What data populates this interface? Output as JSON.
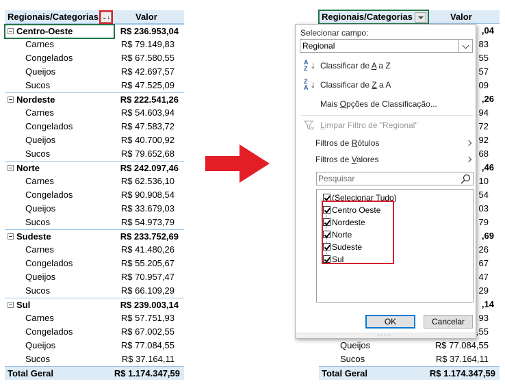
{
  "left_table": {
    "header": {
      "name": "Regionais/Categorias",
      "value": "Valor"
    },
    "groups": [
      {
        "region": "Centro-Oeste",
        "total": "R$ 236.953,04",
        "items": [
          {
            "name": "Carnes",
            "value": "R$ 79.149,83"
          },
          {
            "name": "Congelados",
            "value": "R$ 67.580,55"
          },
          {
            "name": "Queijos",
            "value": "R$ 42.697,57"
          },
          {
            "name": "Sucos",
            "value": "R$ 47.525,09"
          }
        ]
      },
      {
        "region": "Nordeste",
        "total": "R$ 222.541,26",
        "items": [
          {
            "name": "Carnes",
            "value": "R$ 54.603,94"
          },
          {
            "name": "Congelados",
            "value": "R$ 47.583,72"
          },
          {
            "name": "Queijos",
            "value": "R$ 40.700,92"
          },
          {
            "name": "Sucos",
            "value": "R$ 79.652,68"
          }
        ]
      },
      {
        "region": "Norte",
        "total": "R$ 242.097,46",
        "items": [
          {
            "name": "Carnes",
            "value": "R$ 62.536,10"
          },
          {
            "name": "Congelados",
            "value": "R$ 90.908,54"
          },
          {
            "name": "Queijos",
            "value": "R$ 33.679,03"
          },
          {
            "name": "Sucos",
            "value": "R$ 54.973,79"
          }
        ]
      },
      {
        "region": "Sudeste",
        "total": "R$ 233.752,69",
        "items": [
          {
            "name": "Carnes",
            "value": "R$ 41.480,26"
          },
          {
            "name": "Congelados",
            "value": "R$ 55.205,67"
          },
          {
            "name": "Queijos",
            "value": "R$ 70.957,47"
          },
          {
            "name": "Sucos",
            "value": "R$ 66.109,29"
          }
        ]
      },
      {
        "region": "Sul",
        "total": "R$ 239.003,14",
        "items": [
          {
            "name": "Carnes",
            "value": "R$ 57.751,93"
          },
          {
            "name": "Congelados",
            "value": "R$ 67.002,55"
          },
          {
            "name": "Queijos",
            "value": "R$ 77.084,55"
          },
          {
            "name": "Sucos",
            "value": "R$ 37.164,11"
          }
        ]
      }
    ],
    "grand_total": {
      "label": "Total Geral",
      "value": "R$ 1.174.347,59"
    }
  },
  "right_table": {
    "header": {
      "name": "Regionais/Categorias",
      "value": "Valor"
    },
    "visible_values": [
      {
        "text": ",04",
        "bold": true
      },
      {
        "text": "83",
        "bold": false
      },
      {
        "text": "55",
        "bold": false
      },
      {
        "text": "57",
        "bold": false
      },
      {
        "text": "09",
        "bold": false
      },
      {
        "text": ",26",
        "bold": true
      },
      {
        "text": "94",
        "bold": false
      },
      {
        "text": "72",
        "bold": false
      },
      {
        "text": "92",
        "bold": false
      },
      {
        "text": "68",
        "bold": false
      },
      {
        "text": ",46",
        "bold": true
      },
      {
        "text": "10",
        "bold": false
      },
      {
        "text": "54",
        "bold": false
      },
      {
        "text": "03",
        "bold": false
      },
      {
        "text": "79",
        "bold": false
      },
      {
        "text": ",69",
        "bold": true
      },
      {
        "text": "26",
        "bold": false
      },
      {
        "text": "67",
        "bold": false
      },
      {
        "text": "47",
        "bold": false
      },
      {
        "text": "29",
        "bold": false
      },
      {
        "text": ",14",
        "bold": true
      },
      {
        "text": "93",
        "bold": false
      },
      {
        "text": ",55",
        "bold": false
      }
    ],
    "bottom_rows": [
      {
        "name": "Queijos",
        "value": "R$ 77.084,55"
      },
      {
        "name": "Sucos",
        "value": "R$ 37.164,11"
      }
    ],
    "grand_total": {
      "label": "Total Geral",
      "value": "R$ 1.174.347,59"
    }
  },
  "menu": {
    "field_label": "Selecionar campo:",
    "field_value": "Regional",
    "sort_asc": {
      "pre": "Classificar de ",
      "key": "A",
      "post": " a Z",
      "icon_top": "A",
      "icon_bottom": "Z"
    },
    "sort_desc": {
      "pre": "Classificar de ",
      "key": "Z",
      "post": " a A",
      "icon_top": "Z",
      "icon_bottom": "A"
    },
    "more_sort": {
      "pre": "Mais ",
      "key": "O",
      "post": "pções de Classificação..."
    },
    "clear_filter": {
      "pre": "",
      "key": "L",
      "post": "impar Filtro de \"Regional\""
    },
    "label_filters": {
      "pre": "Filtros de ",
      "key": "R",
      "post": "ótulos"
    },
    "value_filters": {
      "pre": "Filtros de ",
      "key": "V",
      "post": "alores"
    },
    "search_placeholder": "Pesquisar",
    "list": [
      {
        "label": "(Selecionar Tudo)",
        "checked": true
      },
      {
        "label": "Centro Oeste",
        "checked": true
      },
      {
        "label": "Nordeste",
        "checked": true
      },
      {
        "label": "Norte",
        "checked": true
      },
      {
        "label": "Sudeste",
        "checked": true
      },
      {
        "label": "Sul",
        "checked": true
      }
    ],
    "ok_label": "OK",
    "cancel_label": "Cancelar"
  },
  "colors": {
    "header_fill": "#ddebf7",
    "border_blue": "#9bc2e6",
    "highlight_red": "#e0202a",
    "selection_green": "#217346",
    "arrow_red": "#e41e26"
  },
  "icons": {
    "collapse": "minus-box-icon",
    "filter_sort": "filter-sort-icon",
    "dropdown": "chevron-down-icon",
    "search": "search-icon",
    "clear_filter": "filter-clear-icon",
    "submenu": "chevron-right-icon",
    "arrow": "right-arrow-icon"
  }
}
